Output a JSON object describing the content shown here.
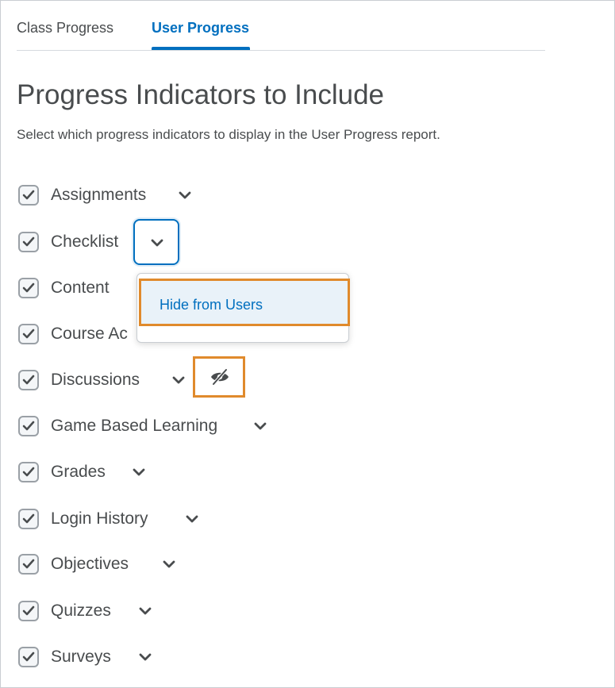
{
  "tabs": [
    {
      "label": "Class Progress"
    },
    {
      "label": "User Progress"
    }
  ],
  "active_tab": "User Progress",
  "page": {
    "title": "Progress Indicators to Include",
    "description": "Select which progress indicators to display in the User Progress report."
  },
  "indicators": [
    {
      "label": "Assignments",
      "checked": true
    },
    {
      "label": "Checklist",
      "checked": true
    },
    {
      "label": "Content",
      "checked": true
    },
    {
      "label": "Course Ac",
      "checked": true
    },
    {
      "label": "Discussions",
      "checked": true,
      "hidden_from_users": true
    },
    {
      "label": "Game Based Learning",
      "checked": true
    },
    {
      "label": "Grades",
      "checked": true
    },
    {
      "label": "Login History",
      "checked": true
    },
    {
      "label": "Objectives",
      "checked": true
    },
    {
      "label": "Quizzes",
      "checked": true
    },
    {
      "label": "Surveys",
      "checked": true
    }
  ],
  "dropdown_menu": {
    "items": [
      {
        "label": "Hide from Users"
      }
    ]
  },
  "icons": {
    "checkbox": "checkmark-icon",
    "dropdown": "chevron-down-icon",
    "hidden": "eye-slash-icon"
  },
  "colors": {
    "accent": "#006fbf",
    "highlight": "#e08a2c",
    "menu_selected_bg": "#e9f2f9"
  }
}
